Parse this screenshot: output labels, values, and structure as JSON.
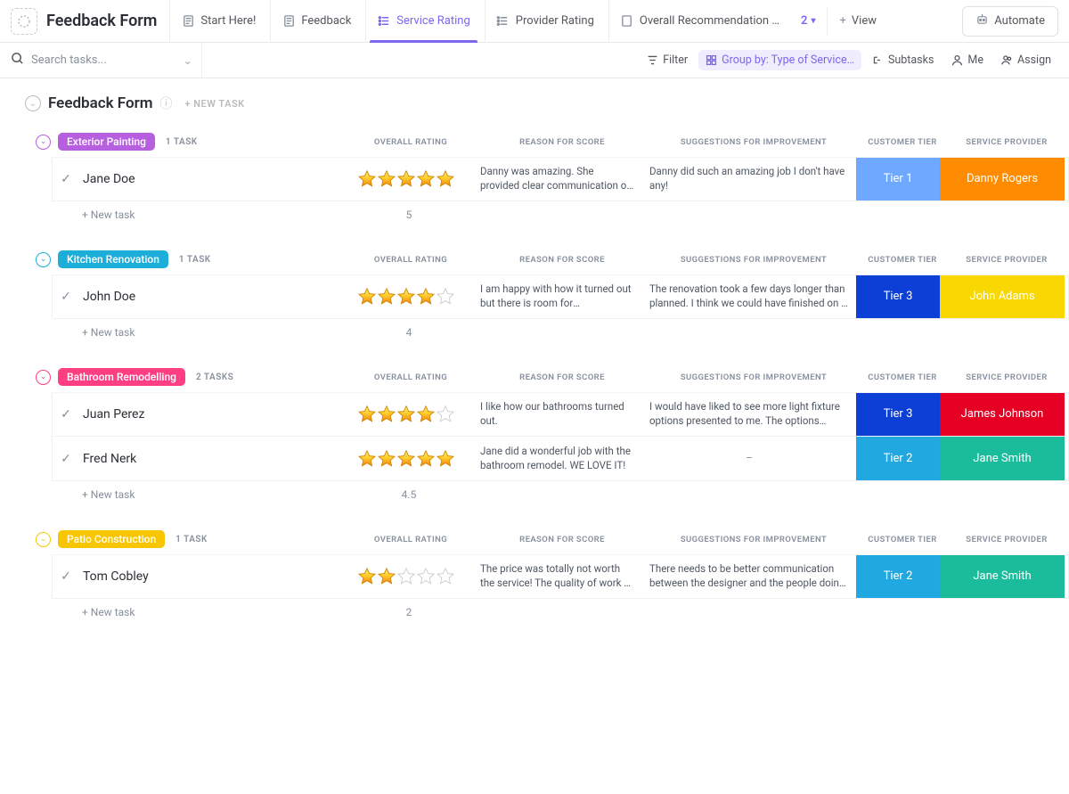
{
  "app": {
    "title": "Feedback Form"
  },
  "tabs": [
    {
      "label": "Start Here!"
    },
    {
      "label": "Feedback"
    },
    {
      "label": "Service Rating"
    },
    {
      "label": "Provider Rating"
    },
    {
      "label": "Overall Recommendation …"
    }
  ],
  "moreCount": "2",
  "viewBtn": "View",
  "automateBtn": "Automate",
  "search": {
    "placeholder": "Search tasks..."
  },
  "toolbar": {
    "filter": "Filter",
    "groupBy": "Group by: Type of Service…",
    "subtasks": "Subtasks",
    "me": "Me",
    "assign": "Assign"
  },
  "list": {
    "title": "Feedback Form",
    "newTaskHead": "+ NEW TASK",
    "newTaskRow": "+ New task"
  },
  "columns": {
    "rating": "OVERALL RATING",
    "reason": "REASON FOR SCORE",
    "sugg": "SUGGESTIONS FOR IMPROVEMENT",
    "tier": "CUSTOMER TIER",
    "provider": "SERVICE PROVIDER"
  },
  "groups": [
    {
      "name": "Exterior Painting",
      "color": "#b660e0",
      "caretColor": "#b660e0",
      "count": "1 TASK",
      "avg": "5",
      "rows": [
        {
          "name": "Jane Doe",
          "stars": 5,
          "reason": "Danny was amazing. She provided clear communication of time…",
          "sugg": "Danny did such an amazing job I don't have any!",
          "tier": "Tier 1",
          "tierBg": "#6fa8ff",
          "provider": "Danny Rogers",
          "provBg": "#ff8b00"
        }
      ]
    },
    {
      "name": "Kitchen Renovation",
      "color": "#1caed9",
      "caretColor": "#1caed9",
      "count": "1 TASK",
      "avg": "4",
      "rows": [
        {
          "name": "John Doe",
          "stars": 4,
          "reason": "I am happy with how it turned out but there is room for improvement",
          "sugg": "The renovation took a few days longer than planned. I think we could have finished on …",
          "tier": "Tier 3",
          "tierBg": "#0b3fd6",
          "provider": "John Adams",
          "provBg": "#f8d800"
        }
      ]
    },
    {
      "name": "Bathroom Remodelling",
      "color": "#ff3f82",
      "caretColor": "#ff3f82",
      "count": "2 TASKS",
      "avg": "4.5",
      "rows": [
        {
          "name": "Juan Perez",
          "stars": 4,
          "reason": "I like how our bathrooms turned out.",
          "sugg": "I would have liked to see more light fixture options presented to me. The options provided…",
          "tier": "Tier 3",
          "tierBg": "#0b3fd6",
          "provider": "James Johnson",
          "provBg": "#e60023"
        },
        {
          "name": "Fred Nerk",
          "stars": 5,
          "reason": "Jane did a wonderful job with the bathroom remodel. WE LOVE IT!",
          "sugg": "–",
          "tier": "Tier 2",
          "tierBg": "#22a8e0",
          "provider": "Jane Smith",
          "provBg": "#1abc9c"
        }
      ]
    },
    {
      "name": "Patio Construction",
      "color": "#f7c600",
      "caretColor": "#f7c600",
      "count": "1 TASK",
      "avg": "2",
      "rows": [
        {
          "name": "Tom Cobley",
          "stars": 2,
          "reason": "The price was totally not worth the service! The quality of work …",
          "sugg": "There needs to be better communication between the designer and the people doing the…",
          "tier": "Tier 2",
          "tierBg": "#22a8e0",
          "provider": "Jane Smith",
          "provBg": "#1abc9c"
        }
      ]
    }
  ]
}
